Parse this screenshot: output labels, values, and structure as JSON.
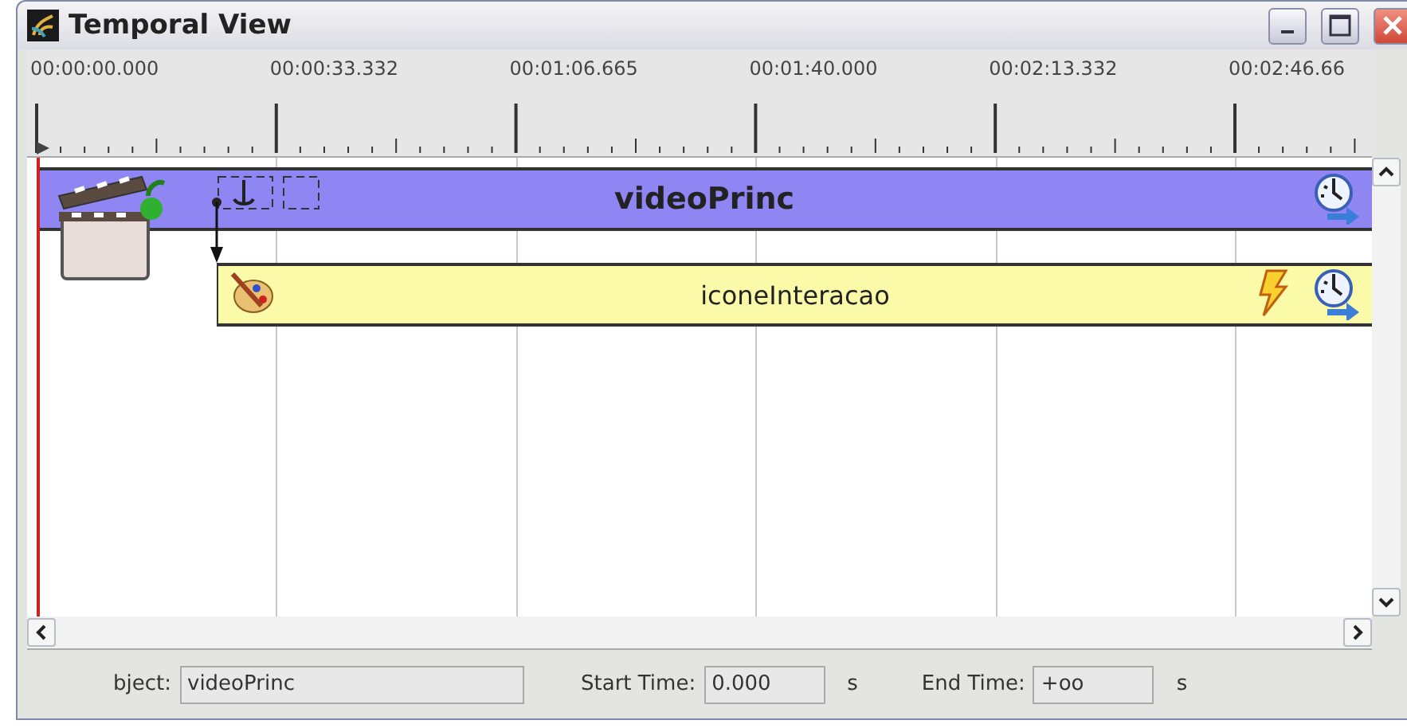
{
  "window": {
    "title": "Temporal View"
  },
  "ruler": {
    "ticks": [
      "00:00:00.000",
      "00:00:33.332",
      "00:01:06.665",
      "00:01:40.000",
      "00:02:13.332",
      "00:02:46.66"
    ]
  },
  "tracks": [
    {
      "label": "videoPrinc",
      "kind": "video"
    },
    {
      "label": "iconeInteracao",
      "kind": "image"
    }
  ],
  "properties": {
    "object_label": "bject:",
    "object_value": "videoPrinc",
    "start_label": "Start Time:",
    "start_value": "0.000",
    "start_unit": "s",
    "end_label": "End Time:",
    "end_value": "+oo",
    "end_unit": "s"
  }
}
